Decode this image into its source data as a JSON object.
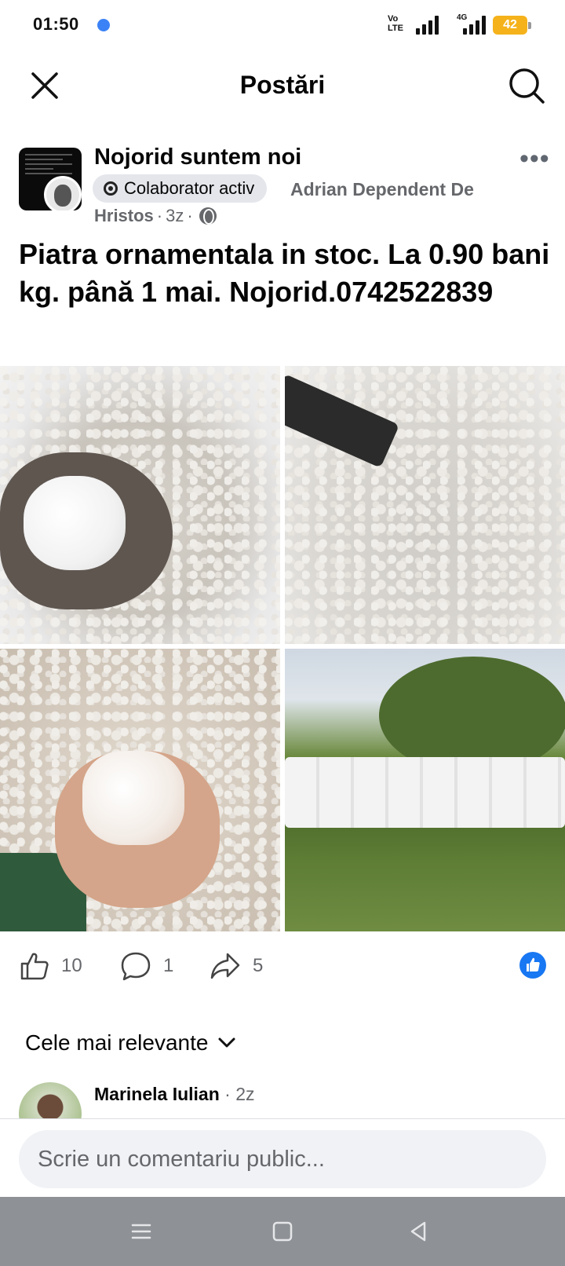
{
  "status_bar": {
    "time": "01:50",
    "volte": "Vo\nLTE",
    "network": "4G",
    "battery": "42"
  },
  "header": {
    "title": "Postări",
    "close_icon": "close-icon",
    "search_icon": "search-icon"
  },
  "post": {
    "group_name": "Nojorid suntem noi",
    "badge_label": "Colaborator activ",
    "author_line1": "Adrian Dependent De",
    "author_line2": "Hristos",
    "time": "3z",
    "visibility_icon": "globe-icon",
    "text": "Piatra ornamentala in stoc. La 0.90 bani kg. până 1 mai. Nojorid.0742522839",
    "photos": [
      "hand-with-white-stones",
      "bag-of-white-stones",
      "hand-with-stones-closeup",
      "pallets-of-bags-outdoors"
    ]
  },
  "actions": {
    "likes": "10",
    "comments": "1",
    "shares": "5"
  },
  "comments_section": {
    "sort_label": "Cele mai relevante",
    "first_comment_author": "Marinela Iulian",
    "first_comment_time": "· 2z"
  },
  "composer": {
    "placeholder": "Scrie un comentariu public..."
  },
  "colors": {
    "brand_blue": "#1877f2",
    "battery": "#f5b21a",
    "nav_bar": "#8e9196"
  }
}
